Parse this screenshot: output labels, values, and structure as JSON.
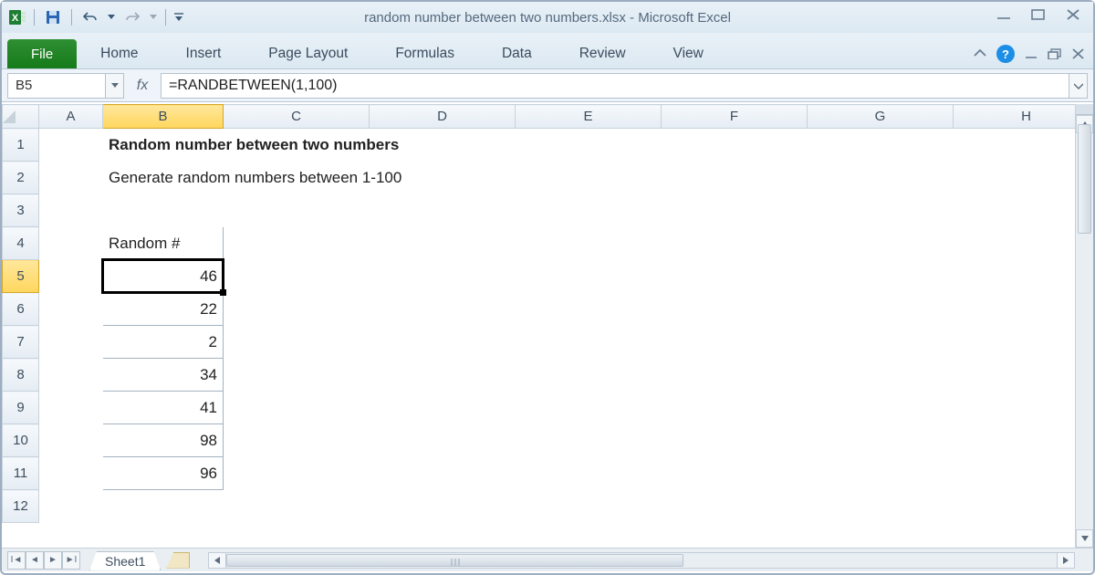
{
  "window": {
    "title": "random number between two numbers.xlsx - Microsoft Excel"
  },
  "ribbon": {
    "file": "File",
    "tabs": [
      "Home",
      "Insert",
      "Page Layout",
      "Formulas",
      "Data",
      "Review",
      "View"
    ]
  },
  "formula_bar": {
    "name_box": "B5",
    "fx_label": "fx",
    "formula": "=RANDBETWEEN(1,100)"
  },
  "grid": {
    "columns": [
      "A",
      "B",
      "C",
      "D",
      "E",
      "F",
      "G",
      "H"
    ],
    "row_numbers": [
      "1",
      "2",
      "3",
      "4",
      "5",
      "6",
      "7",
      "8",
      "9",
      "10",
      "11",
      "12"
    ],
    "active_col": "B",
    "active_row": "5",
    "title_cell": {
      "row": "1",
      "col": "B",
      "text": "Random number between two numbers"
    },
    "subtitle_cell": {
      "row": "2",
      "col": "B",
      "text": "Generate random numbers between 1-100"
    },
    "header_cell": {
      "row": "4",
      "col": "B",
      "text": "Random #"
    },
    "data_values": [
      "46",
      "22",
      "2",
      "34",
      "41",
      "98",
      "96"
    ]
  },
  "sheet_tabs": {
    "active": "Sheet1"
  }
}
